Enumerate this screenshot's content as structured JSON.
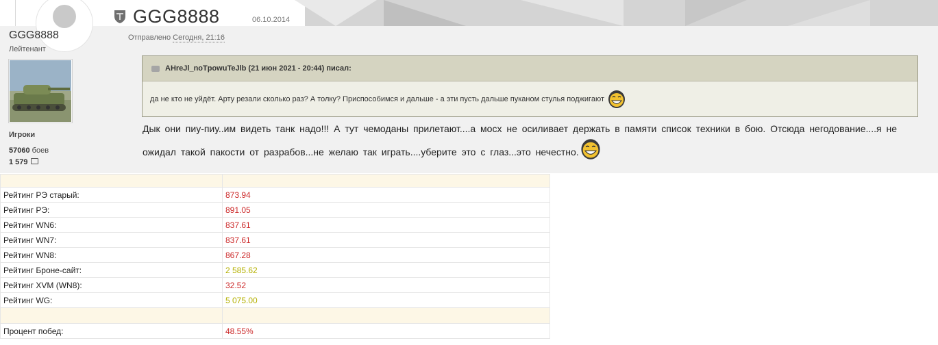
{
  "post": {
    "author": "GGG8888",
    "date": "06.10.2014",
    "sent_prefix": "Отправлено",
    "sent_when": "Сегодня, 21:16"
  },
  "user": {
    "name": "GGG8888",
    "rank": "Лейтенант",
    "group": "Игроки",
    "battles_count": "57060",
    "battles_label": "боев",
    "posts_count": "1 579"
  },
  "quote": {
    "title": "AHreJl_noTpowuTeJlb (21 июн 2021 - 20:44) писал:",
    "text": "да не кто не уйдёт. Арту резали сколько раз? А толку? Приспособимся и дальше - а эти пусть дальше пуканом стулья поджигают"
  },
  "message": "Дык  они  пиу-пиу..им  видеть танк надо!!! А тут чемоданы  прилетают....а мосх не  осиливает держать в  памяти список  техники в бою. Отсюда  негодование....я  не  ожидал такой  пакости от разрабов...не  желаю так  играть....уберите  это с  глаз...это нечестно.",
  "icons": {
    "header": "world-of-tanks-logo-icon",
    "quote": "quote-icon",
    "smiley": "laughing-smiley-icon",
    "posts": "speech-bubble-icon"
  },
  "stats": {
    "group1": [
      {
        "label": "Рейтинг РЭ старый:",
        "value": "873.94",
        "color": "#cc2a2a"
      },
      {
        "label": "Рейтинг РЭ:",
        "value": "891.05",
        "color": "#cc2a2a"
      },
      {
        "label": "Рейтинг WN6:",
        "value": "837.61",
        "color": "#cc2a2a"
      },
      {
        "label": "Рейтинг WN7:",
        "value": "837.61",
        "color": "#cc2a2a"
      },
      {
        "label": "Рейтинг WN8:",
        "value": "867.28",
        "color": "#cc2a2a"
      },
      {
        "label": "Рейтинг Броне-сайт:",
        "value": "2 585.62",
        "color": "#b4b000"
      },
      {
        "label": "Рейтинг XVM (WN8):",
        "value": "32.52",
        "color": "#cc2a2a"
      },
      {
        "label": "Рейтинг WG:",
        "value": "5 075.00",
        "color": "#b4b000"
      }
    ],
    "group2": [
      {
        "label": "Процент побед:",
        "value": "48.55%",
        "color": "#cc2a2a"
      }
    ]
  }
}
